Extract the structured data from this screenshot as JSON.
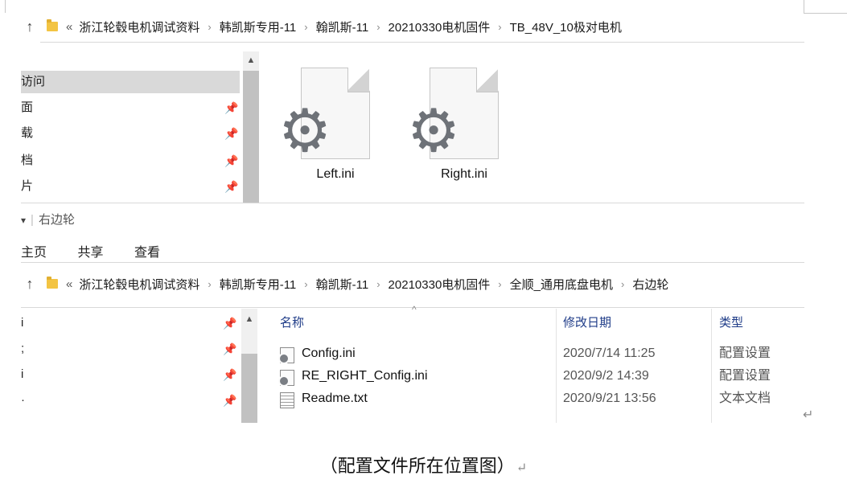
{
  "window1": {
    "breadcrumb": {
      "up_icon": "↑",
      "overflow": "«",
      "crumbs": [
        "浙江轮毂电机调试资料",
        "韩凯斯专用-11",
        "翰凯斯-11",
        "20210330电机固件",
        "TB_48V_10极对电机"
      ],
      "separator": "›"
    },
    "nav": {
      "items": [
        "访问",
        "面",
        "载",
        "档",
        "片"
      ],
      "pin_icon": "pin-icon"
    },
    "files": [
      {
        "name": "Left.ini",
        "icon": "settings-file-icon"
      },
      {
        "name": "Right.ini",
        "icon": "settings-file-icon"
      }
    ]
  },
  "window2": {
    "title": {
      "qa_icon": "▾",
      "divider": "|",
      "folder_name": "右边轮"
    },
    "tabs": [
      "主页",
      "共享",
      "查看"
    ],
    "breadcrumb": {
      "up_icon": "↑",
      "overflow": "«",
      "crumbs": [
        "浙江轮毂电机调试资料",
        "韩凯斯专用-11",
        "翰凯斯-11",
        "20210330电机固件",
        "全顺_通用底盘电机",
        "右边轮"
      ],
      "separator": "›"
    },
    "nav": {
      "items": [
        "i",
        ";",
        "i",
        "·"
      ]
    },
    "columns": {
      "name": "名称",
      "date": "修改日期",
      "type": "类型"
    },
    "rows": [
      {
        "name": "Config.ini",
        "date": "2020/7/14 11:25",
        "type": "配置设置",
        "icon": "settings-file-icon"
      },
      {
        "name": "RE_RIGHT_Config.ini",
        "date": "2020/9/2 14:39",
        "type": "配置设置",
        "icon": "settings-file-icon"
      },
      {
        "name": "Readme.txt",
        "date": "2020/9/21 13:56",
        "type": "文本文档",
        "icon": "text-file-icon"
      }
    ]
  },
  "document": {
    "caption": "（配置文件所在位置图）",
    "return_mark": "↵"
  }
}
